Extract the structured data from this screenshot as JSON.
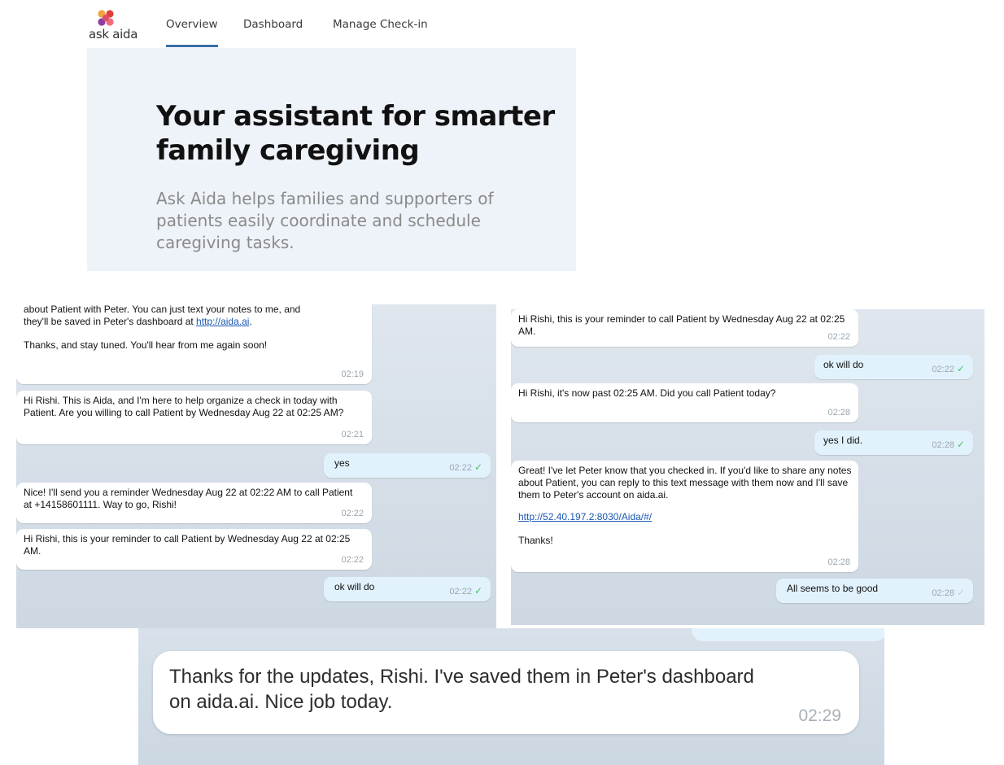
{
  "site": {
    "logo_text": "ask aida",
    "nav": [
      "Overview",
      "Dashboard",
      "Manage Check-in"
    ],
    "hero_title": "Your assistant for smarter family caregiving",
    "hero_subtitle": "Ask Aida helps families and supporters of patients easily coordinate and schedule caregiving tasks."
  },
  "chat_left": {
    "messages": [
      {
        "dir": "in",
        "lines": [
          "about Patient with Peter. You can just text your notes to me, and",
          "they'll be saved in Peter's dashboard at "
        ],
        "link": "http://aida.ai",
        "after": ".",
        "extra": "Thanks, and stay tuned. You'll hear from me again soon!",
        "time": "02:19"
      },
      {
        "dir": "in",
        "text": "Hi Rishi. This is Aida, and I'm here to help organize a check in today with Patient. Are you willing to call Patient by Wednesday Aug 22 at 02:25 AM?",
        "time": "02:21"
      },
      {
        "dir": "out",
        "text": "yes",
        "time": "02:22"
      },
      {
        "dir": "in",
        "text": "Nice! I'll send you a reminder Wednesday Aug 22 at 02:22 AM to call Patient at +14158601111. Way to go, Rishi!",
        "time": "02:22"
      },
      {
        "dir": "in",
        "text": "Hi Rishi, this is your reminder to call Patient by Wednesday Aug 22 at 02:25 AM.",
        "time": "02:22"
      },
      {
        "dir": "out",
        "text": "ok will do",
        "time": "02:22"
      }
    ]
  },
  "chat_right": {
    "messages": [
      {
        "dir": "in",
        "text": "Hi Rishi, this is your reminder to call Patient by Wednesday Aug 22 at 02:25 AM.",
        "time": "02:22"
      },
      {
        "dir": "out",
        "text": "ok will do",
        "time": "02:22"
      },
      {
        "dir": "in",
        "text": "Hi Rishi, it's now past 02:25 AM. Did you call Patient today?",
        "time": "02:28"
      },
      {
        "dir": "out",
        "text": "yes I did.",
        "time": "02:28"
      },
      {
        "dir": "in",
        "text": "Great! I've let Peter know that you checked in. If you'd like to share any notes about Patient, you can reply to this text message with them now and I'll save them to Peter's account on aida.ai.",
        "link": "http://52.40.197.2:8030/Aida/#/",
        "extra": "Thanks!",
        "time": "02:28"
      },
      {
        "dir": "out",
        "text": "All seems to be good",
        "time": "02:28"
      }
    ]
  },
  "zoom": {
    "text": "Thanks for the updates, Rishi. I've saved them in Peter's dashboard on aida.ai. Nice job today.",
    "time": "02:29"
  },
  "colors": {
    "accent": "#3a6fa8",
    "hero_bg": "#eef2f9",
    "out_bubble": "#e1f2fd",
    "check": "#4fbf6b"
  }
}
